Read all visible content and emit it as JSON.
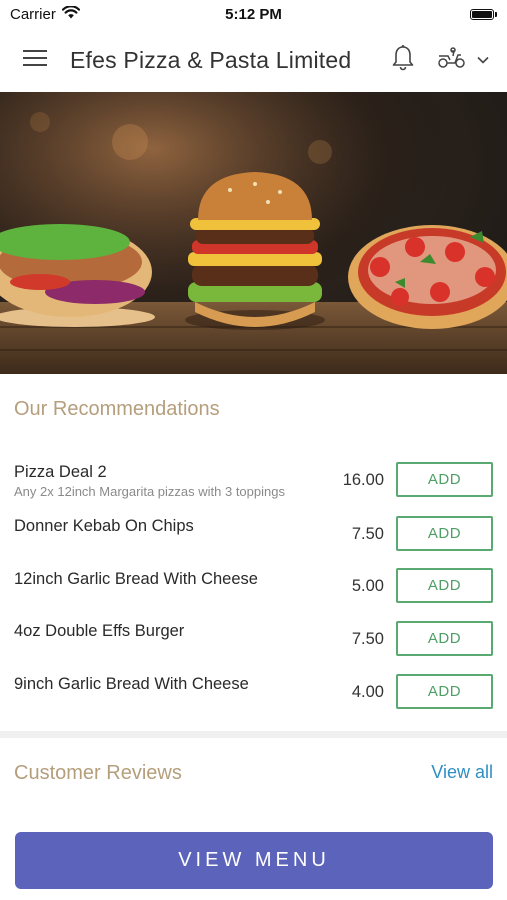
{
  "status_bar": {
    "carrier": "Carrier",
    "time": "5:12 PM"
  },
  "header": {
    "title": "Efes Pizza & Pasta Limited"
  },
  "hero": {
    "image": "food-banner-kebab-burger-pizza"
  },
  "recommendations": {
    "title": "Our Recommendations",
    "items": [
      {
        "name": "Pizza Deal 2",
        "description": "Any 2x 12inch Margarita pizzas with 3 toppings",
        "price": "16.00",
        "add_label": "ADD"
      },
      {
        "name": "Donner Kebab On Chips",
        "description": "",
        "price": "7.50",
        "add_label": "ADD"
      },
      {
        "name": "12inch Garlic Bread With Cheese",
        "description": "",
        "price": "5.00",
        "add_label": "ADD"
      },
      {
        "name": "4oz Double Effs Burger",
        "description": "",
        "price": "7.50",
        "add_label": "ADD"
      },
      {
        "name": "9inch Garlic Bread With Cheese",
        "description": "",
        "price": "4.00",
        "add_label": "ADD"
      }
    ]
  },
  "reviews": {
    "title": "Customer Reviews",
    "view_all_label": "View all"
  },
  "footer": {
    "view_menu_label": "VIEW MENU"
  },
  "colors": {
    "accent_gold": "#b59e7c",
    "add_green": "#5aa970",
    "link_blue": "#2f8fc3",
    "button_purple": "#5b63bb"
  }
}
